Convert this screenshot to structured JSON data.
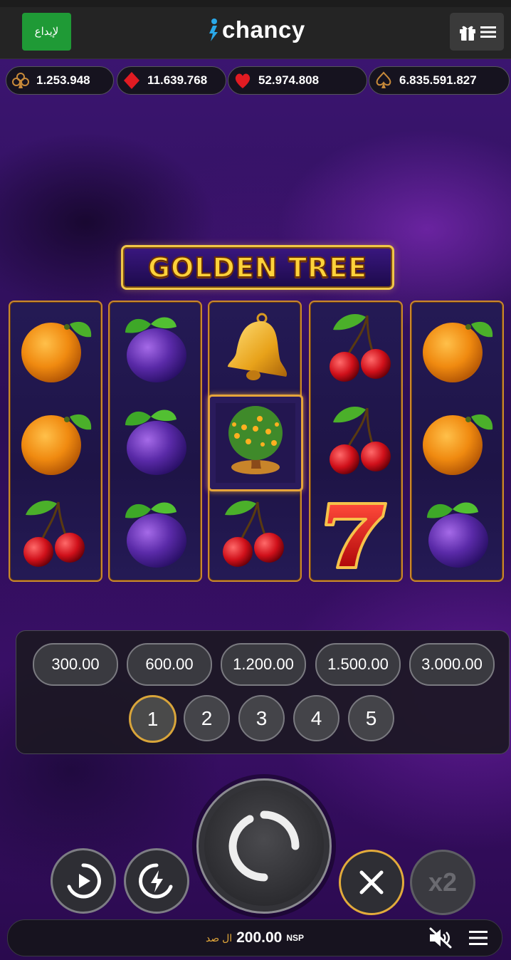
{
  "header": {
    "deposit_label": "لإيداع",
    "logo_text": "chancy"
  },
  "jackpots": [
    {
      "suit": "club",
      "value": "1.253.948"
    },
    {
      "suit": "diamond",
      "value": "11.639.768"
    },
    {
      "suit": "heart",
      "value": "52.974.808"
    },
    {
      "suit": "spade",
      "value": "6.835.591.827"
    }
  ],
  "game": {
    "title": "GOLDEN TREE",
    "reels": [
      [
        "orange-icon",
        "orange-icon",
        "cherry-icon"
      ],
      [
        "plum-icon",
        "plum-icon",
        "plum-icon"
      ],
      [
        "bell-icon",
        "golden-tree-icon",
        "cherry-icon"
      ],
      [
        "cherry-icon",
        "cherry-icon",
        "seven-icon"
      ],
      [
        "orange-icon",
        "orange-icon",
        "plum-icon"
      ]
    ],
    "highlighted_cell": {
      "reel": 3,
      "row": 2
    }
  },
  "bets": {
    "amounts": [
      "300.00",
      "600.00",
      "1.200.00",
      "1.500.00",
      "3.000.00"
    ],
    "lines": [
      "1",
      "2",
      "3",
      "4",
      "5"
    ],
    "selected_line": "1"
  },
  "controls": {
    "autoplay": "autoplay-icon",
    "turbo": "turbo-icon",
    "spin": "spin-icon",
    "cancel": "close-icon",
    "double_label": "x2"
  },
  "footer": {
    "balance_label": "ال صد",
    "balance_amount": "200.00",
    "currency": "NSP"
  },
  "colors": {
    "accent_gold": "#e2ab3b",
    "deposit_green": "#1f9a36",
    "background_purple": "#2c0e55"
  }
}
